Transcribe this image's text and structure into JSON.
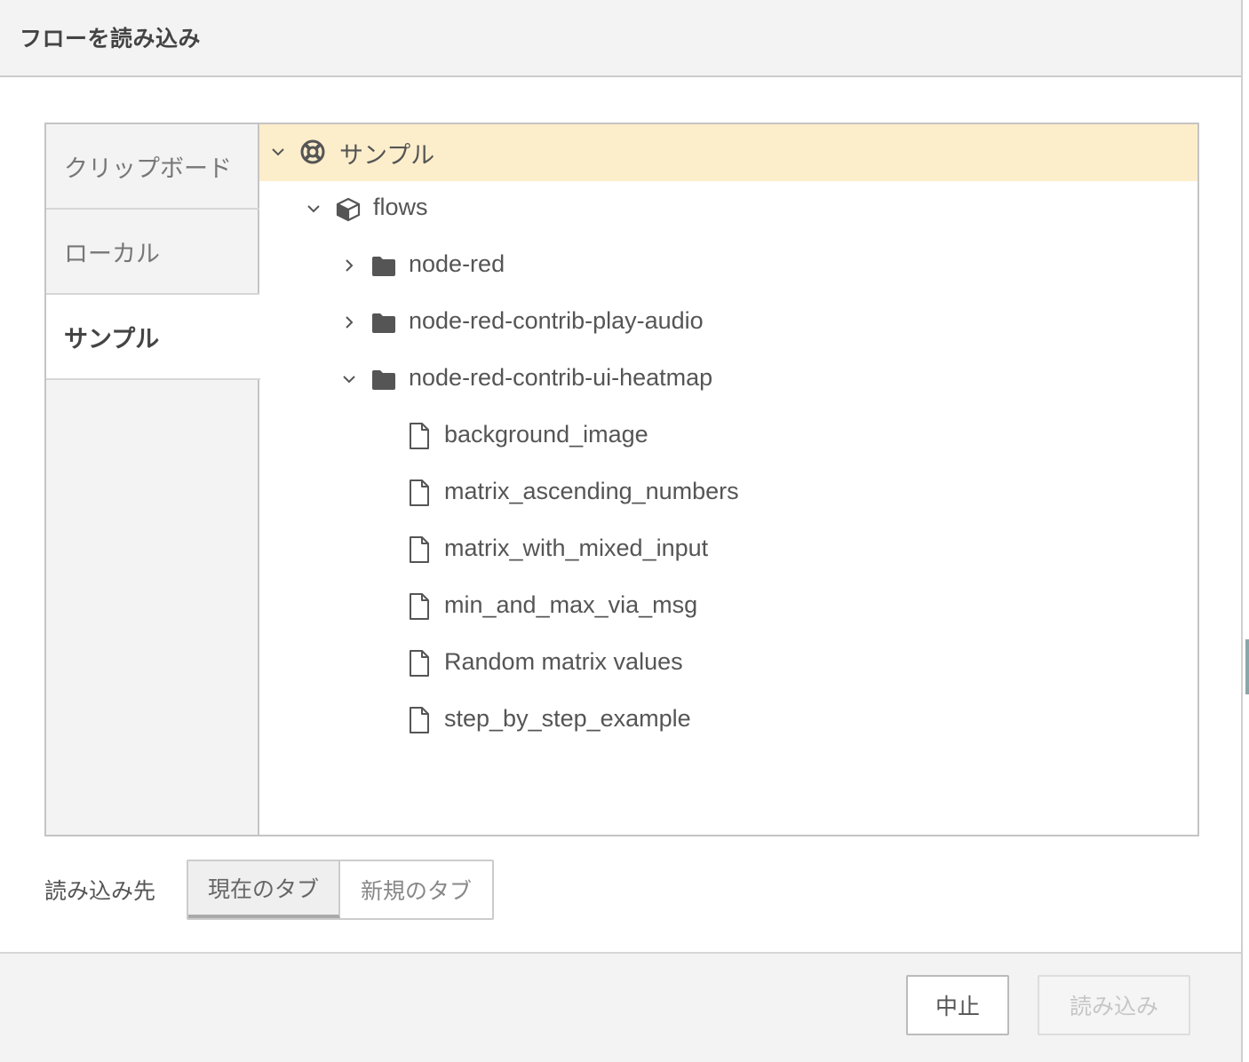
{
  "dialog": {
    "title": "フローを読み込み"
  },
  "side_tabs": [
    {
      "label": "クリップボード",
      "active": false
    },
    {
      "label": "ローカル",
      "active": false
    },
    {
      "label": "サンプル",
      "active": true
    }
  ],
  "tree": {
    "root": {
      "label": "サンプル",
      "expanded": true,
      "selected": true,
      "icon": "life-ring-icon"
    },
    "module": {
      "label": "flows",
      "expanded": true,
      "icon": "cube-icon"
    },
    "folders": [
      {
        "label": "node-red",
        "expanded": false,
        "icon": "folder-icon"
      },
      {
        "label": "node-red-contrib-play-audio",
        "expanded": false,
        "icon": "folder-icon"
      },
      {
        "label": "node-red-contrib-ui-heatmap",
        "expanded": true,
        "icon": "folder-icon"
      }
    ],
    "files": [
      {
        "label": "background_image",
        "icon": "file-icon"
      },
      {
        "label": "matrix_ascending_numbers",
        "icon": "file-icon"
      },
      {
        "label": "matrix_with_mixed_input",
        "icon": "file-icon"
      },
      {
        "label": "min_and_max_via_msg",
        "icon": "file-icon"
      },
      {
        "label": "Random matrix values",
        "icon": "file-icon"
      },
      {
        "label": "step_by_step_example",
        "icon": "file-icon"
      }
    ]
  },
  "import_target": {
    "label": "読み込み先",
    "options": [
      "現在のタブ",
      "新規のタブ"
    ],
    "selected": "現在のタブ"
  },
  "buttons": {
    "cancel": "中止",
    "import": "読み込み"
  },
  "colors": {
    "selected_row": "#fdeecb",
    "header_bg": "#f3f3f3",
    "border": "#c4c4c4"
  }
}
